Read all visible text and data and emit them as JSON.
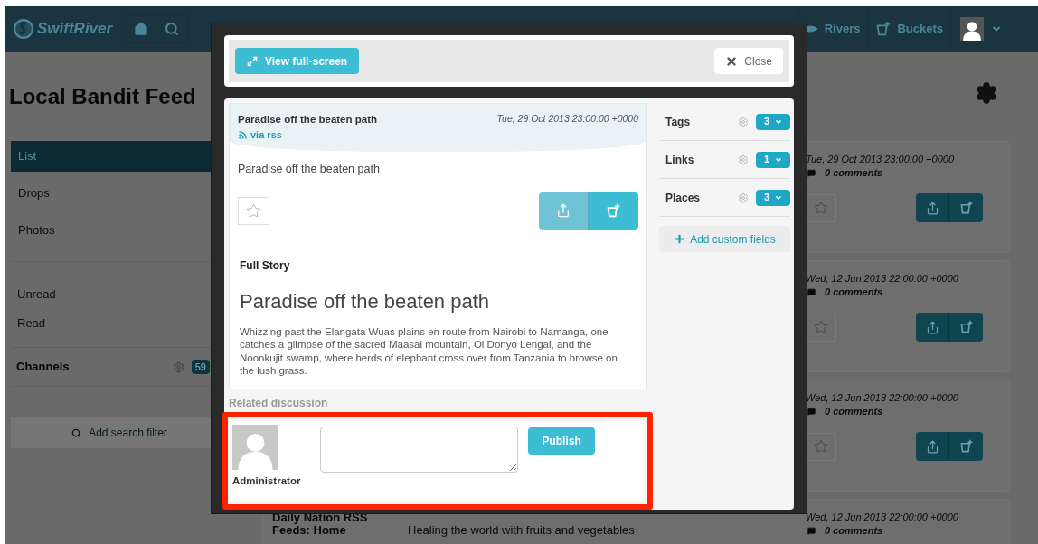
{
  "header": {
    "logo": "SwiftRiver",
    "nav": [
      {
        "kind": "rivers",
        "label": "Rivers"
      },
      {
        "kind": "buckets",
        "label": "Buckets"
      }
    ]
  },
  "page": {
    "title": "Local Bandit Feed"
  },
  "sidebar": {
    "views": [
      {
        "label": "List",
        "selected": true
      },
      {
        "label": "Drops",
        "selected": false
      },
      {
        "label": "Photos",
        "selected": false
      }
    ],
    "filters": [
      {
        "label": "Unread"
      },
      {
        "label": "Read"
      }
    ],
    "channels": {
      "label": "Channels",
      "count": "59"
    },
    "add_filter": "Add search filter"
  },
  "drops": [
    {
      "date": "Tue, 29 Oct 2013 23:00:00 +0000",
      "comments": "0 comments"
    },
    {
      "date": "Wed, 12 Jun 2013 22:00:00 +0000",
      "comments": "0 comments"
    },
    {
      "date": "Wed, 12 Jun 2013 22:00:00 +0000",
      "comments": "0 comments"
    },
    {
      "source": "Daily Nation RSS Feeds: Home",
      "text": "Healing the world with fruits and vegetables",
      "date": "Wed, 12 Jun 2013 22:00:00 +0000",
      "comments": "0 comments"
    }
  ],
  "modal": {
    "toolbar": {
      "fullscreen": "View full-screen",
      "close": "Close"
    },
    "drop": {
      "title": "Paradise off the beaten path",
      "via": "via rss",
      "date": "Tue, 29 Oct 2013 23:00:00 +0000",
      "summary": "Paradise off the beaten path",
      "full_story": {
        "label": "Full Story",
        "headline": "Paradise off the beaten path",
        "body": "Whizzing past the Elangata Wuas plains en route from Nairobi to Namanga, one catches a glimpse of the sacred Maasai mountain, Ol Donyo Lengai, and the Noonkujit swamp, where herds of elephant cross over from Tanzania to browse on the lush grass."
      }
    },
    "meta": [
      {
        "label": "Tags",
        "count": "3"
      },
      {
        "label": "Links",
        "count": "1"
      },
      {
        "label": "Places",
        "count": "3"
      }
    ],
    "add_fields": "Add custom fields",
    "discussion": {
      "label": "Related discussion",
      "user": "Administrator",
      "publish": "Publish"
    }
  }
}
